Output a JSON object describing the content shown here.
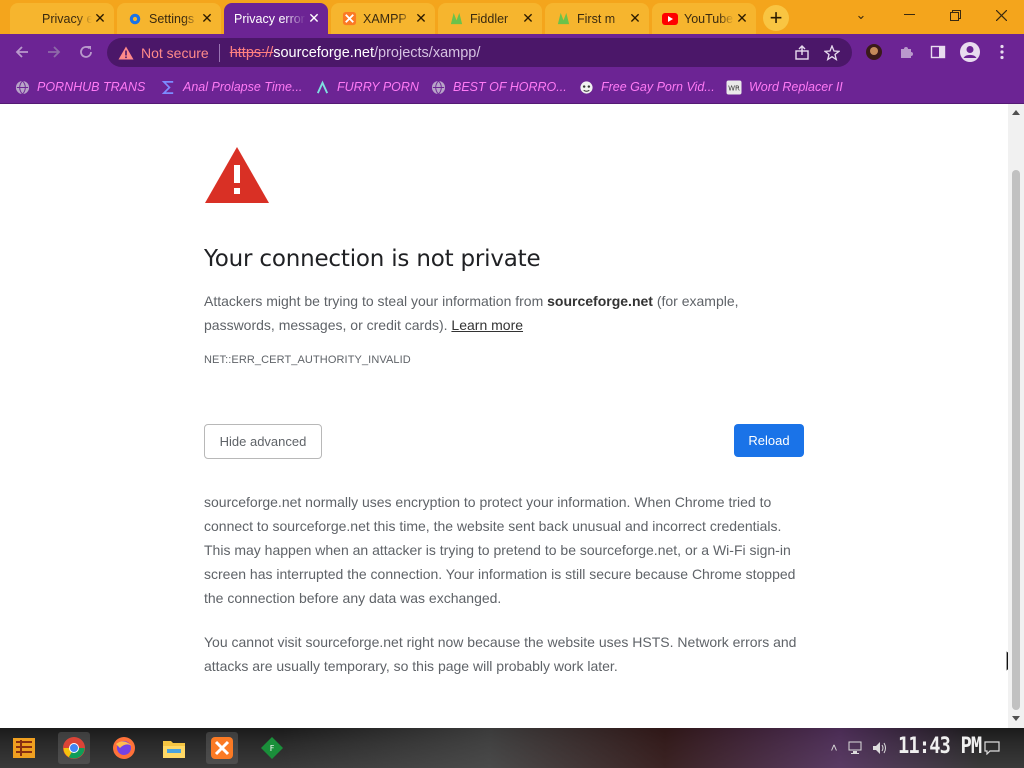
{
  "tabs": [
    {
      "title": "Privacy error",
      "active": false,
      "icon": "warning-icon"
    },
    {
      "title": "Settings",
      "active": false,
      "icon": "gear-icon"
    },
    {
      "title": "Privacy error",
      "active": true,
      "icon": "warning-icon"
    },
    {
      "title": "XAMPP",
      "active": false,
      "icon": "xampp-icon"
    },
    {
      "title": "Fiddler",
      "active": false,
      "icon": "fiddler-icon"
    },
    {
      "title": "First m",
      "active": false,
      "icon": "fiddler-icon"
    },
    {
      "title": "YouTube",
      "active": false,
      "icon": "youtube-icon"
    }
  ],
  "omnibox": {
    "security_label": "Not secure",
    "scheme": "https://",
    "host": "sourceforge.net",
    "path": "/projects/xampp/"
  },
  "bookmarks": [
    {
      "label": "PORNHUB TRANS",
      "icon": "globe-icon"
    },
    {
      "label": "Anal Prolapse Time...",
      "icon": "sigma-icon"
    },
    {
      "label": "FURRY PORN",
      "icon": "lambda-icon"
    },
    {
      "label": "BEST OF HORRO...",
      "icon": "globe-icon"
    },
    {
      "label": "Free Gay Porn Vid...",
      "icon": "mask-icon"
    },
    {
      "label": "Word Replacer II",
      "icon": "wr-icon"
    }
  ],
  "page": {
    "title": "Your connection is not private",
    "explanation_pre": "Attackers might be trying to steal your information from ",
    "explanation_host": "sourceforge.net",
    "explanation_post": " (for example, passwords, messages, or credit cards). ",
    "learn_more": "Learn more",
    "error_code": "NET::ERR_CERT_AUTHORITY_INVALID",
    "hide_advanced_label": "Hide advanced",
    "reload_label": "Reload",
    "details_1": "sourceforge.net normally uses encryption to protect your information. When Chrome tried to connect to sourceforge.net this time, the website sent back unusual and incorrect credentials. This may happen when an attacker is trying to pretend to be sourceforge.net, or a Wi-Fi sign-in screen has interrupted the connection. Your information is still secure because Chrome stopped the connection before any data was exchanged.",
    "details_2": "You cannot visit sourceforge.net right now because the website uses HSTS. Network errors and attacks are usually temporary, so this page will probably work later."
  },
  "taskbar": {
    "clock": "11:43 PM",
    "apps": [
      "start-icon",
      "chrome-icon",
      "firefox-icon",
      "file-explorer-icon",
      "xampp-icon",
      "app-icon"
    ]
  },
  "colors": {
    "tabstrip": "#f4a51c",
    "toolbar": "#6c2494",
    "bookmark_text": "#ff7af5",
    "warning_red": "#d93025",
    "reload_blue": "#1a73e8"
  }
}
